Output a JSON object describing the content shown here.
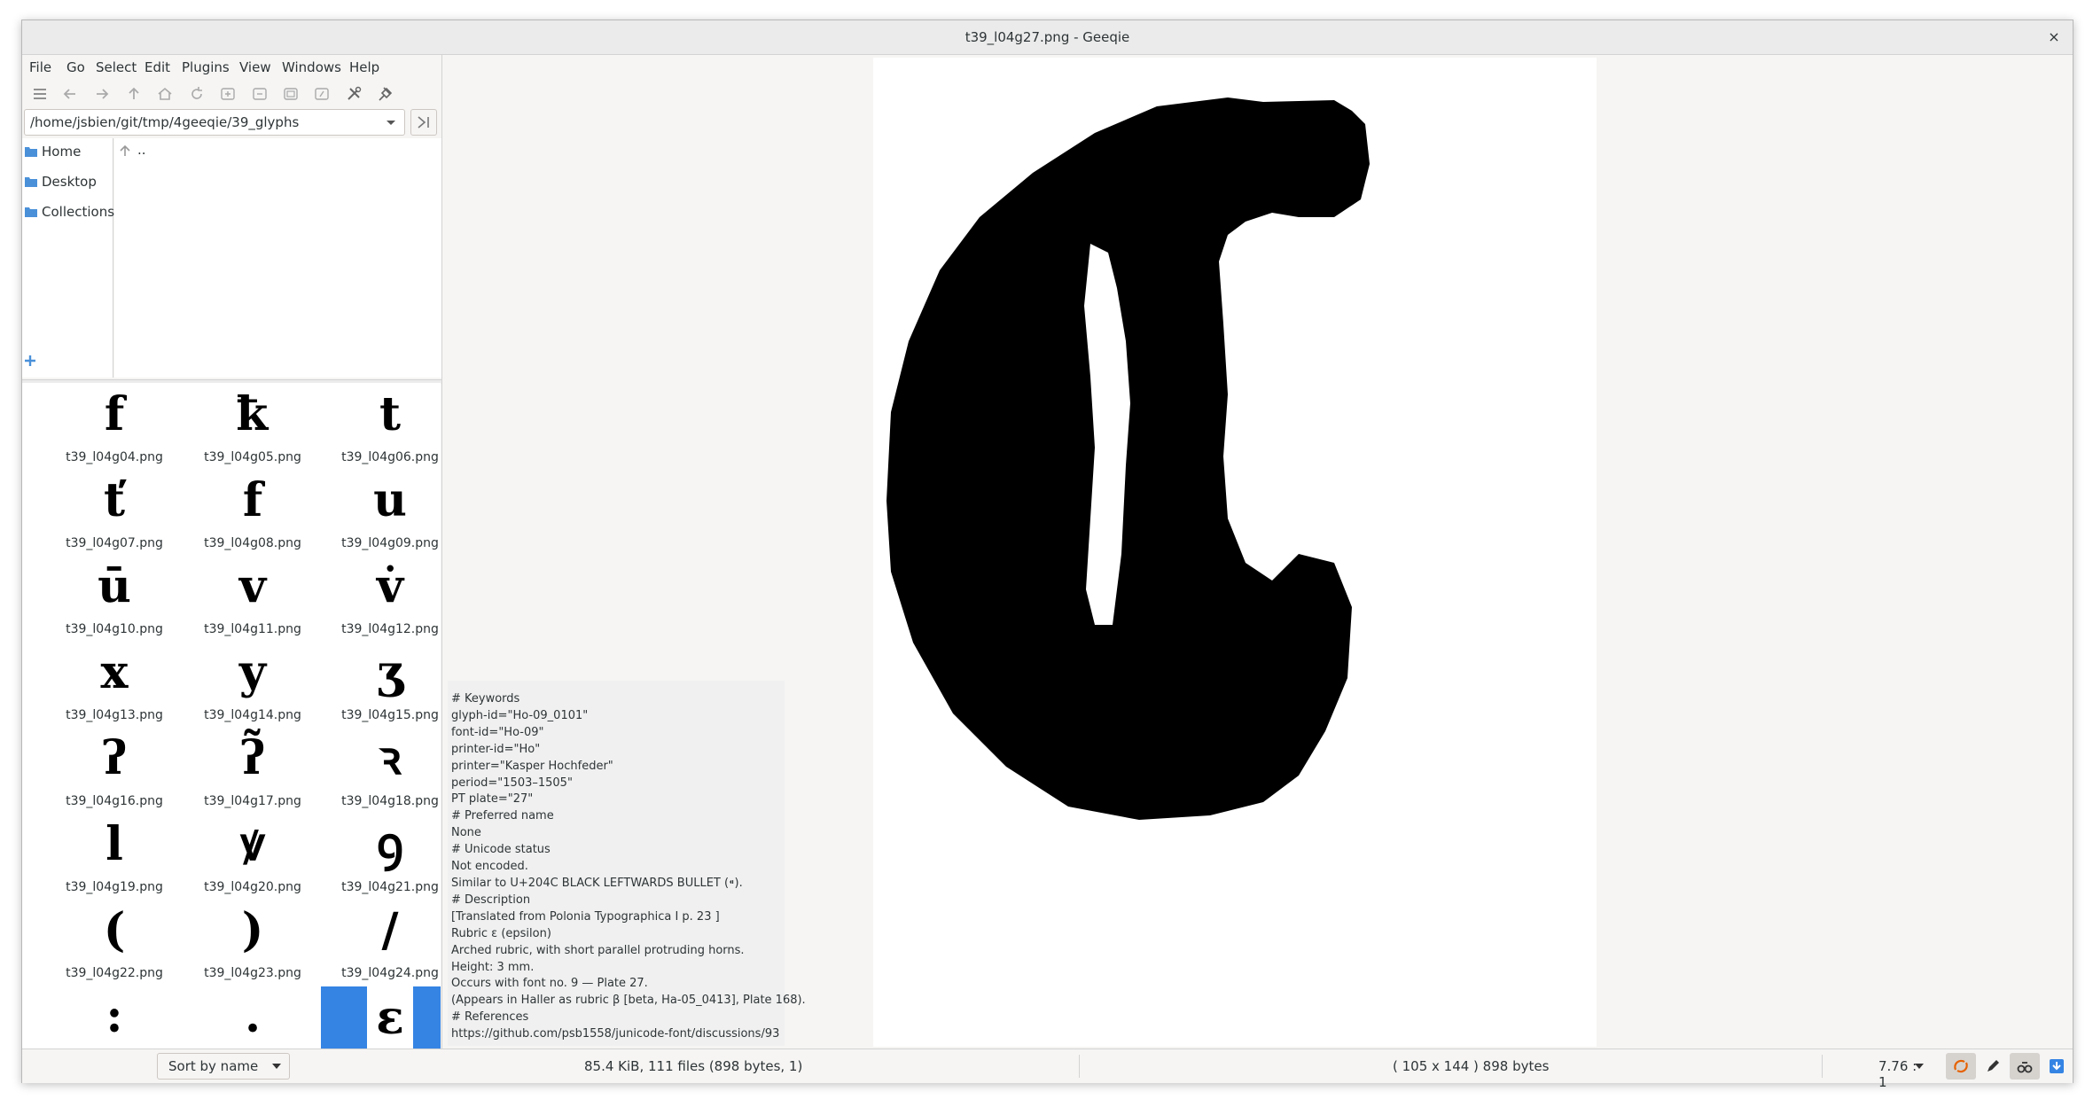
{
  "window": {
    "title": "t39_l04g27.png - Geeqie",
    "close_glyph": "×"
  },
  "menubar": [
    "File",
    "Go",
    "Select",
    "Edit",
    "Plugins",
    "View",
    "Windows",
    "Help"
  ],
  "toolbar_icons": [
    "list-view-icon",
    "back-icon",
    "forward-icon",
    "up-icon",
    "home-icon",
    "refresh-icon",
    "zoom-in-icon",
    "zoom-out-icon",
    "zoom-fit-icon",
    "zoom-100-icon",
    "preferences-icon",
    "pin-icon"
  ],
  "path": {
    "value": "/home/jsbien/git/tmp/4geeqie/39_glyphs"
  },
  "bookmarks": [
    "Home",
    "Desktop",
    "Collections"
  ],
  "file_list": [
    ".."
  ],
  "thumbnails": [
    {
      "name": "t39_l04g04.png",
      "glyph": "f"
    },
    {
      "name": "t39_l04g05.png",
      "glyph": "ꝁ"
    },
    {
      "name": "t39_l04g06.png",
      "glyph": "t"
    },
    {
      "name": "t39_l04g07.png",
      "glyph": "ť"
    },
    {
      "name": "t39_l04g08.png",
      "glyph": "f"
    },
    {
      "name": "t39_l04g09.png",
      "glyph": "u"
    },
    {
      "name": "t39_l04g10.png",
      "glyph": "ū"
    },
    {
      "name": "t39_l04g11.png",
      "glyph": "v"
    },
    {
      "name": "t39_l04g12.png",
      "glyph": "v̇"
    },
    {
      "name": "t39_l04g13.png",
      "glyph": "x"
    },
    {
      "name": "t39_l04g14.png",
      "glyph": "y"
    },
    {
      "name": "t39_l04g15.png",
      "glyph": "ʒ"
    },
    {
      "name": "t39_l04g16.png",
      "glyph": "ʔ"
    },
    {
      "name": "t39_l04g17.png",
      "glyph": "ʔ̃"
    },
    {
      "name": "t39_l04g18.png",
      "glyph": "ꝛ"
    },
    {
      "name": "t39_l04g19.png",
      "glyph": "l"
    },
    {
      "name": "t39_l04g20.png",
      "glyph": "ꝟ"
    },
    {
      "name": "t39_l04g21.png",
      "glyph": "ꝯ"
    },
    {
      "name": "t39_l04g22.png",
      "glyph": "("
    },
    {
      "name": "t39_l04g23.png",
      "glyph": ")"
    },
    {
      "name": "t39_l04g24.png",
      "glyph": "/"
    },
    {
      "name": "",
      "glyph": ":"
    },
    {
      "name": "",
      "glyph": "."
    },
    {
      "name": "",
      "glyph": "ɛ",
      "selected": true
    }
  ],
  "overlay": {
    "lines": [
      "# Keywords",
      "glyph-id=\"Ho-09_0101\"",
      "font-id=\"Ho-09\"",
      "printer-id=\"Ho\"",
      "printer=\"Kasper Hochfeder\"",
      "period=\"1503–1505\"",
      "PT plate=\"27\"",
      "# Preferred name",
      "None",
      "# Unicode status",
      "Not encoded.",
      "Similar to U+204C BLACK LEFTWARDS BULLET (⁌).",
      "# Description",
      "[Translated from Polonia Typographica I p. 23 ]",
      "Rubric ε (epsilon)",
      "Arched rubric, with short parallel protruding horns.",
      "Height: 3 mm.",
      "Occurs with font no. 9 — Plate 27.",
      "(Appears in Haller as rubric β [beta, Ha-05_0413], Plate 168).",
      "# References",
      "https://github.com/psb1558/junicode-font/discussions/93"
    ]
  },
  "statusbar": {
    "sort_label": "Sort by name",
    "files_info": "85.4 KiB, 111 files (898 bytes, 1)",
    "image_info": "( 105 x 144 ) 898 bytes",
    "zoom": "7.76 : 1"
  },
  "colors": {
    "selection": "#3584e4",
    "folder": "#4a90d9"
  }
}
